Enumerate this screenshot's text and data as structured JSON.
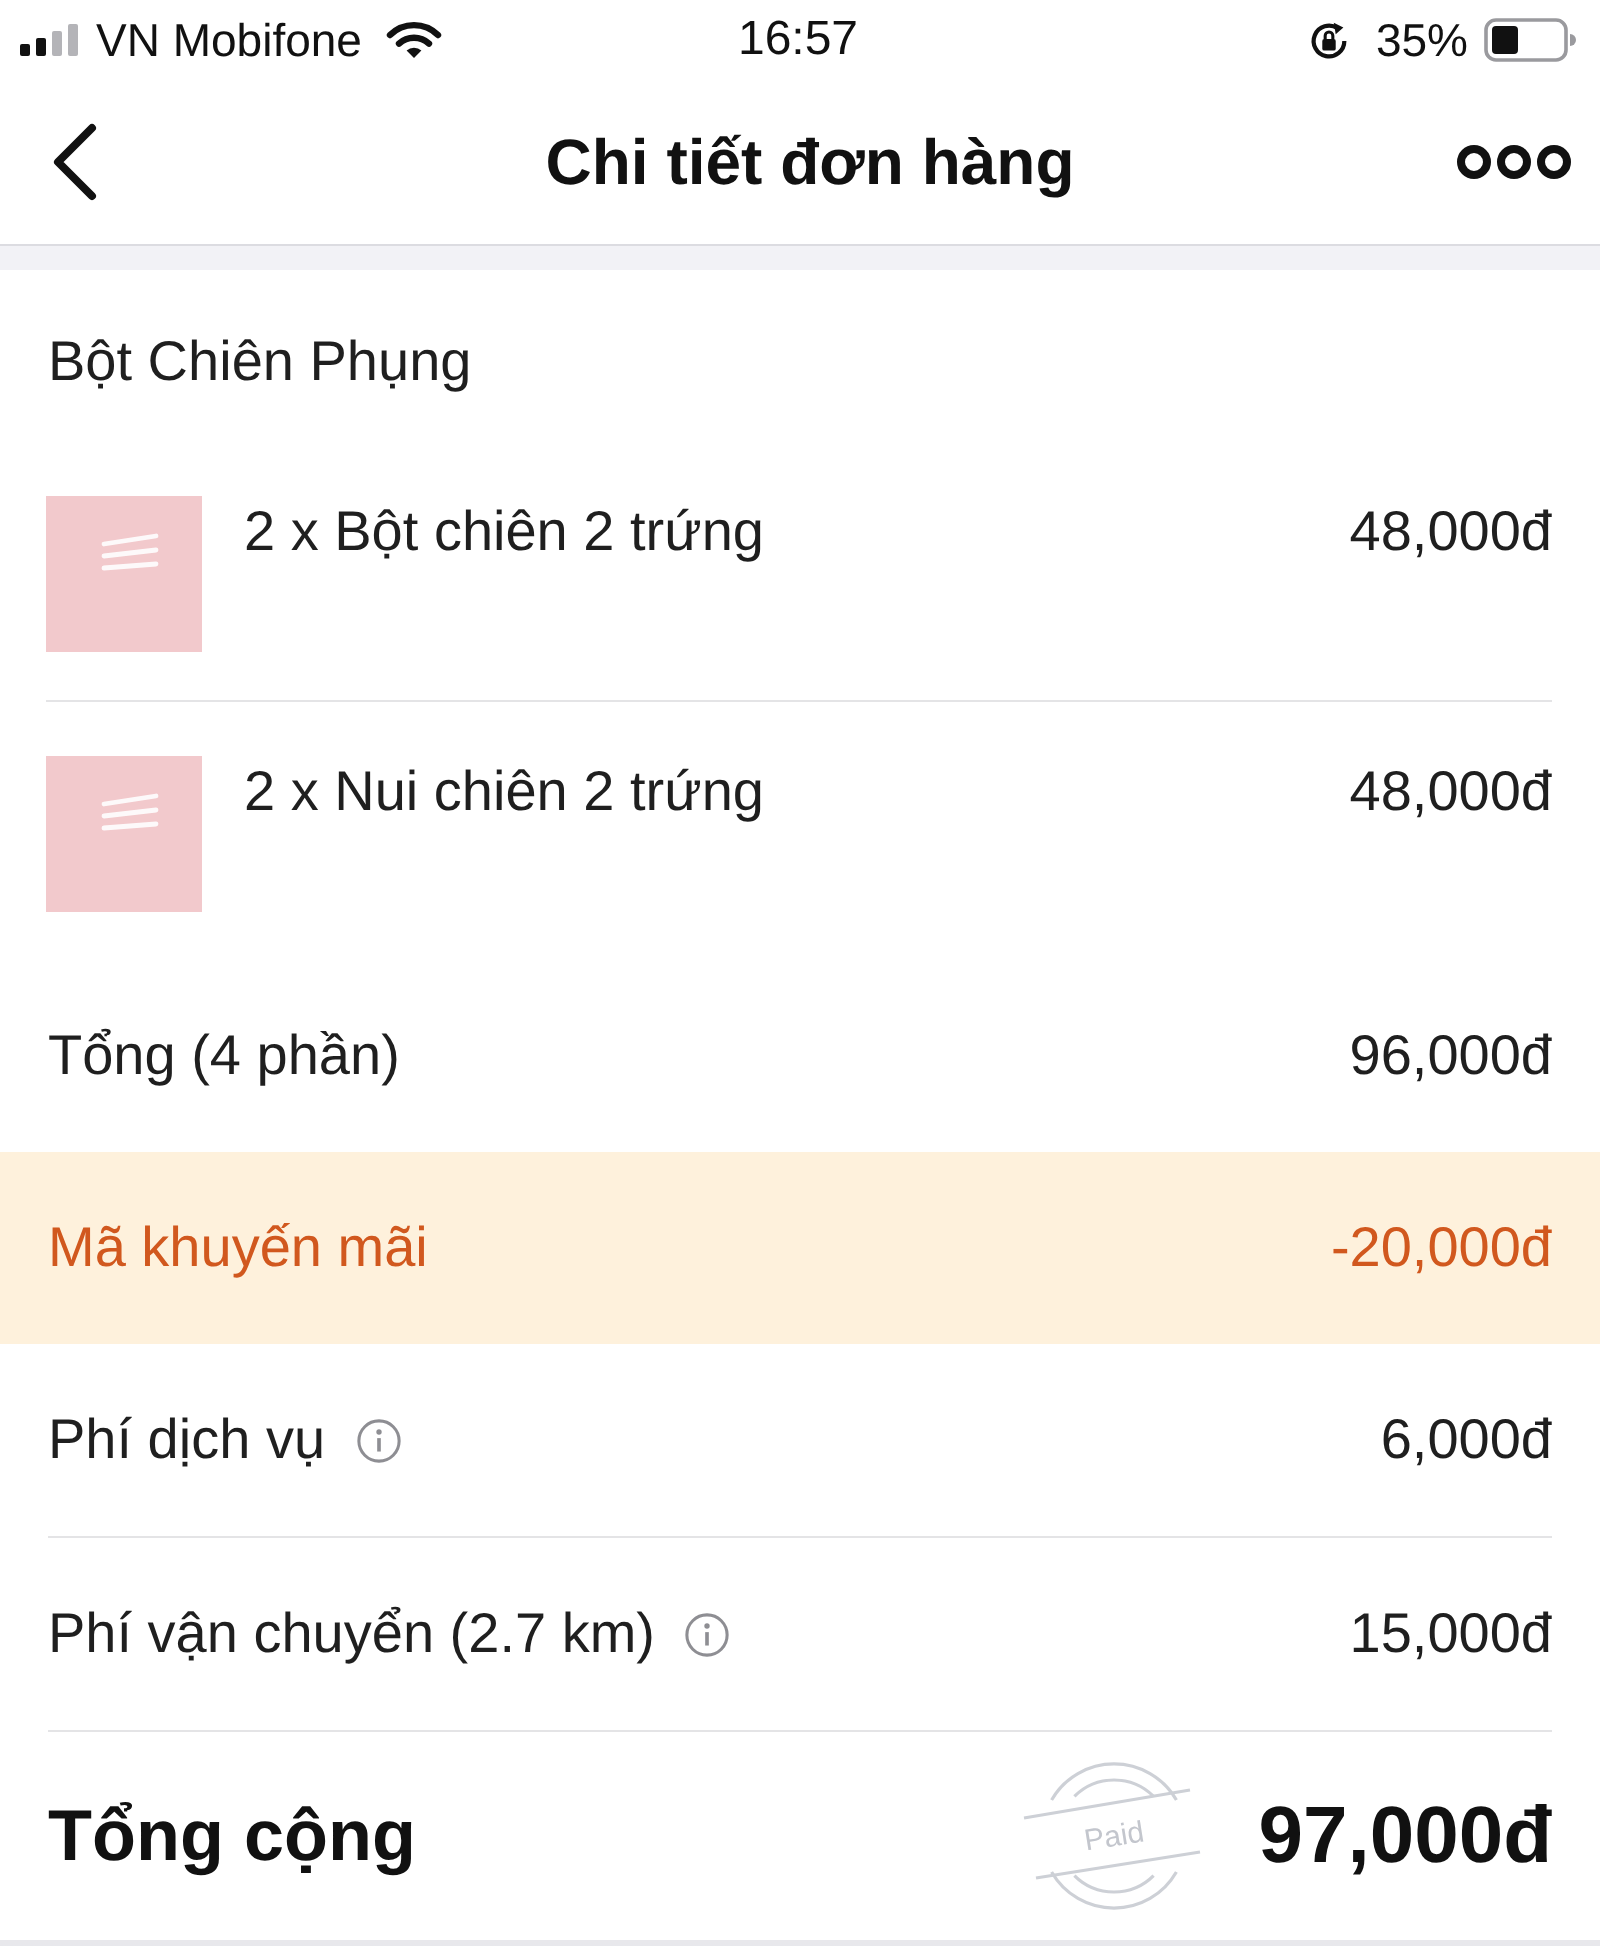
{
  "status_bar": {
    "carrier": "VN Mobifone",
    "time": "16:57",
    "battery": "35%"
  },
  "nav_bar": {
    "title": "Chi tiết đơn hàng"
  },
  "order": {
    "restaurant": "Bột Chiên Phụng",
    "items": [
      {
        "label": "2 x Bột chiên 2 trứng",
        "price": "48,000đ"
      },
      {
        "label": "2 x Nui chiên 2 trứng",
        "price": "48,000đ"
      }
    ]
  },
  "summary": [
    {
      "kind": "subtotal",
      "label": "Tổng (4 phần)",
      "info": false,
      "amount": "96,000đ"
    },
    {
      "kind": "promo",
      "label": "Mã khuyến mãi",
      "info": false,
      "amount": "-20,000đ"
    },
    {
      "kind": "fee",
      "label": "Phí dịch vụ",
      "info": true,
      "amount": "6,000đ"
    },
    {
      "kind": "fee",
      "label": "Phí vận chuyển (2.7 km)",
      "info": true,
      "amount": "15,000đ"
    }
  ],
  "total": {
    "label": "Tổng cộng",
    "stamp": "Paid",
    "amount": "97,000đ"
  }
}
